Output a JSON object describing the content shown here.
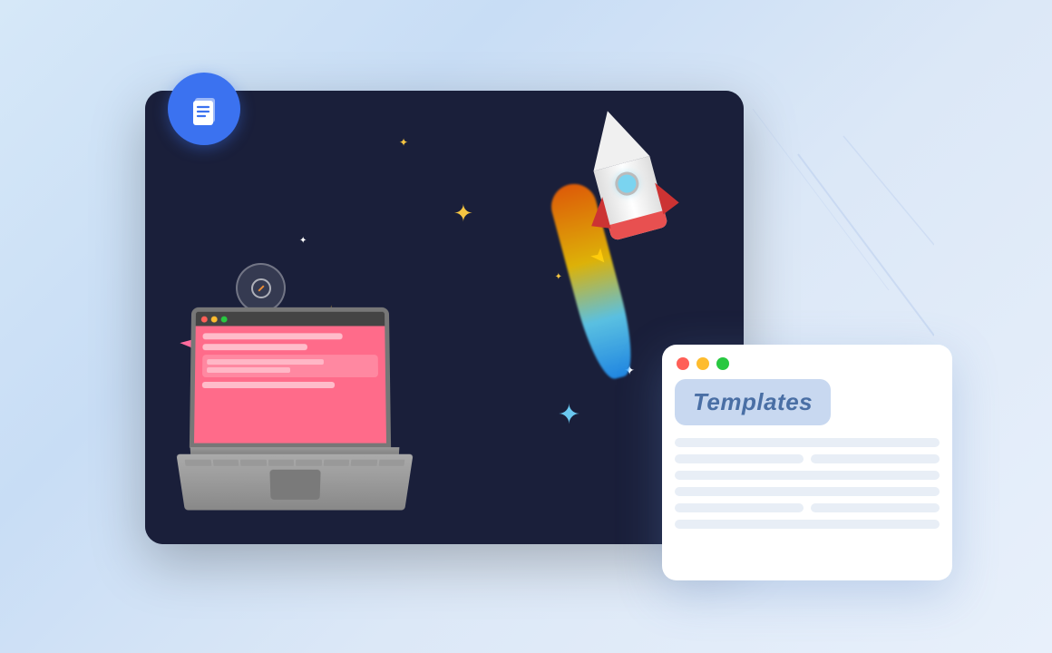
{
  "scene": {
    "background": "#cce0f5",
    "icon_circle": {
      "color": "#3b72f0",
      "icon_name": "document-copy-icon"
    },
    "templates_card": {
      "title": "Templates",
      "traffic_lights": [
        "red",
        "yellow",
        "green"
      ],
      "content_lines": 8
    },
    "stars": [
      {
        "size": "big",
        "symbol": "✦",
        "color": "#f5c542"
      },
      {
        "size": "big",
        "symbol": "✦",
        "color": "#f5c542"
      },
      {
        "size": "small",
        "symbol": "✦",
        "color": "#7ec8f5"
      },
      {
        "size": "small",
        "symbol": "✦",
        "color": "#f5c542"
      }
    ]
  }
}
